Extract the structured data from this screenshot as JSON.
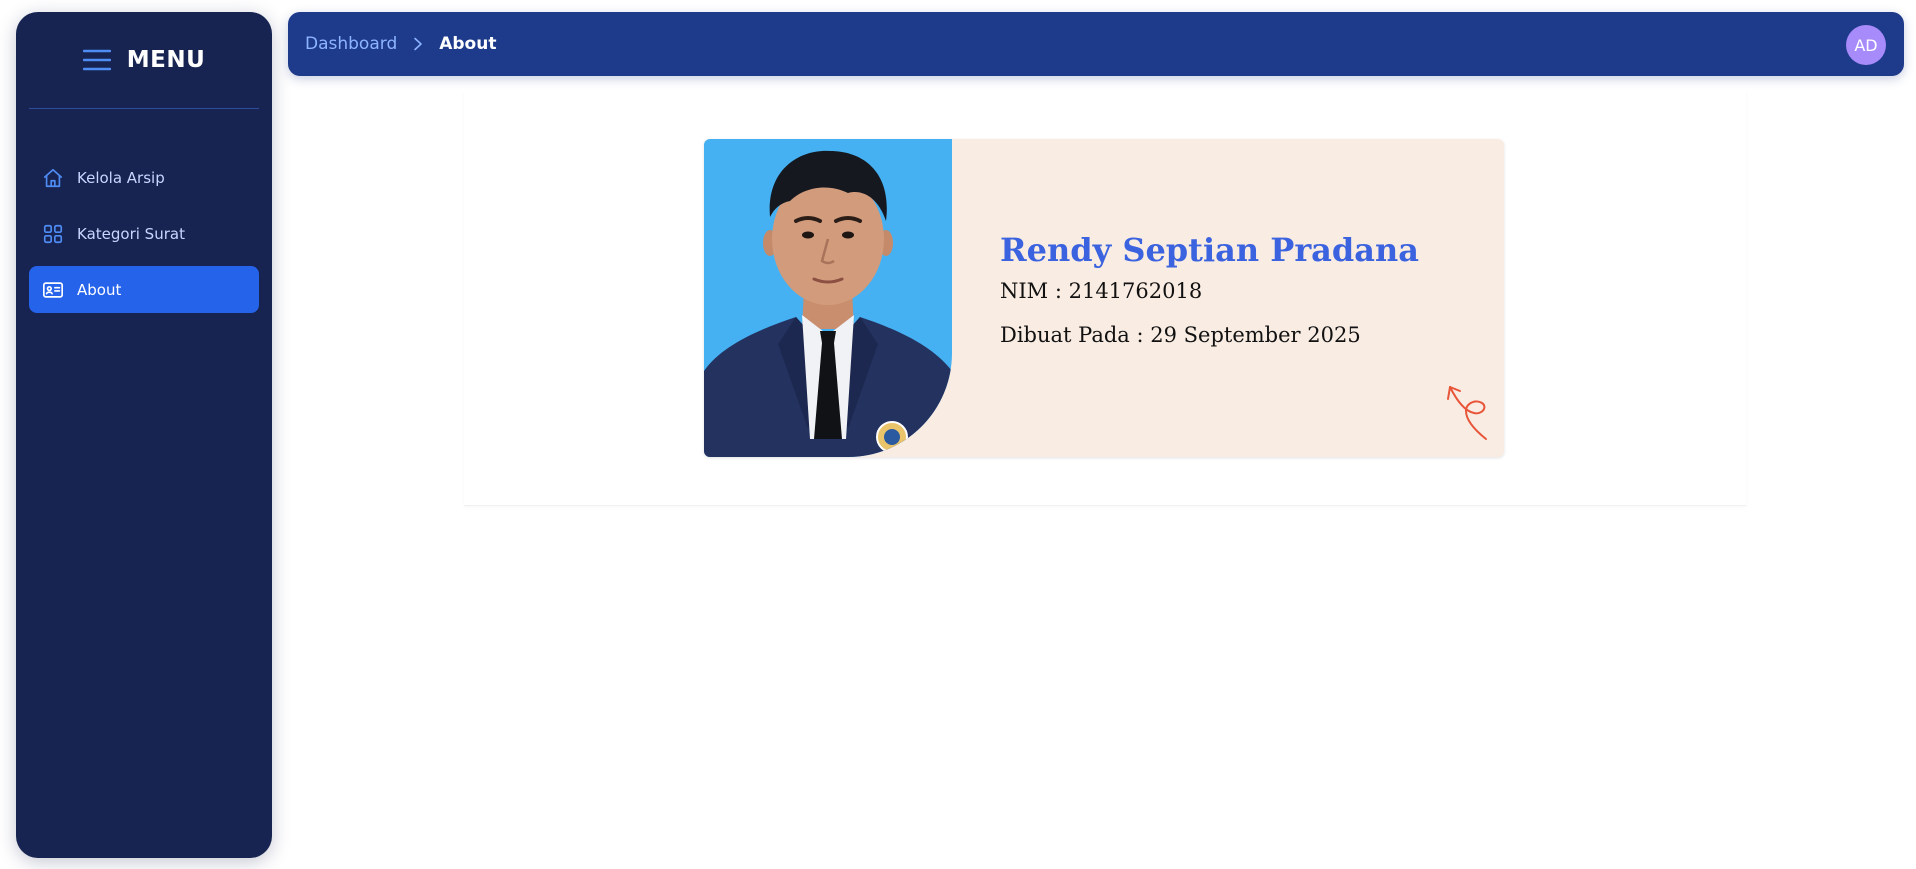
{
  "sidebar": {
    "title": "MENU",
    "items": [
      {
        "label": "Kelola Arsip",
        "icon": "home-icon",
        "active": false
      },
      {
        "label": "Kategori Surat",
        "icon": "grid-icon",
        "active": false
      },
      {
        "label": "About",
        "icon": "id-card-icon",
        "active": true
      }
    ]
  },
  "header": {
    "breadcrumb_link": "Dashboard",
    "breadcrumb_current": "About",
    "avatar_initials": "AD"
  },
  "profile": {
    "name": "Rendy Septian Pradana",
    "nim": "NIM : 2141762018",
    "created": "Dibuat Pada : 29 September 2025"
  },
  "colors": {
    "sidebar_bg": "#172350",
    "topbar_bg": "#1e3a8a",
    "active_item": "#2563eb",
    "card_bg": "#f9ece3",
    "photo_bg": "#45b1f2",
    "name_color": "#3b63df",
    "avatar_bg": "#a78bfa",
    "doodle": "#e8563a"
  }
}
